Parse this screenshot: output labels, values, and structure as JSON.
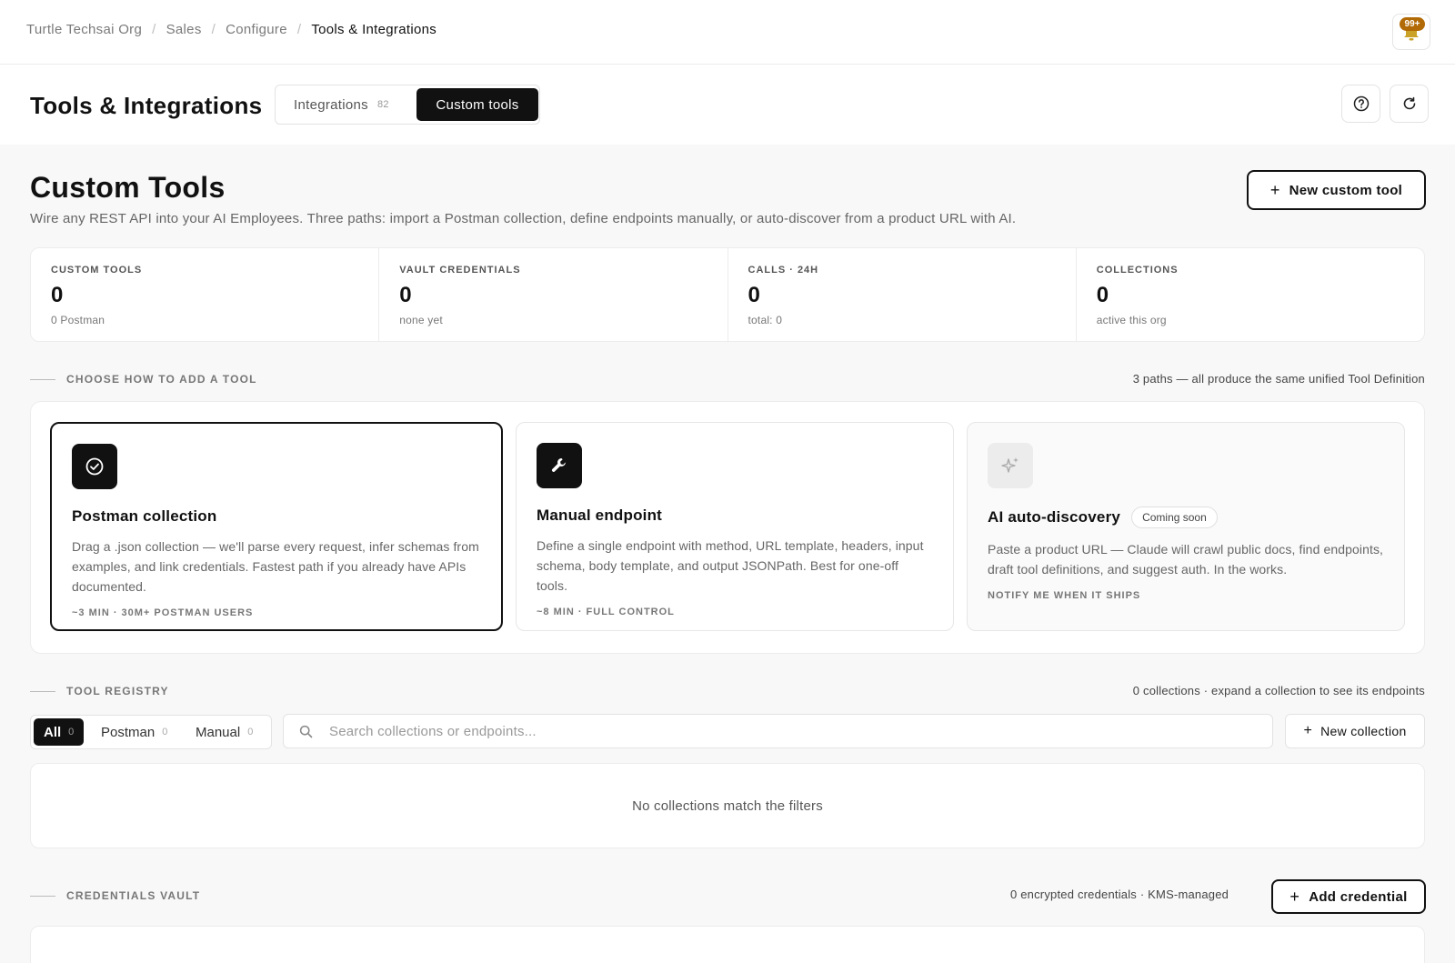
{
  "breadcrumb": [
    "Turtle Techsai Org",
    "Sales",
    "Configure",
    "Tools & Integrations"
  ],
  "notifications": {
    "badge": "99+"
  },
  "header": {
    "title": "Tools & Integrations",
    "tabs": [
      {
        "label": "Integrations",
        "count": "82"
      },
      {
        "label": "Custom tools"
      }
    ]
  },
  "custom_tools": {
    "title": "Custom Tools",
    "subtitle": "Wire any REST API into your AI Employees. Three paths: import a Postman collection, define endpoints manually, or auto-discover from a product URL with AI.",
    "new_button": "New custom tool"
  },
  "stats": [
    {
      "label": "CUSTOM TOOLS",
      "value": "0",
      "sub": "0 Postman"
    },
    {
      "label": "VAULT CREDENTIALS",
      "value": "0",
      "sub": "none yet"
    },
    {
      "label": "CALLS · 24H",
      "value": "0",
      "sub": "total: 0"
    },
    {
      "label": "COLLECTIONS",
      "value": "0",
      "sub": "active this org"
    }
  ],
  "choose": {
    "label": "CHOOSE HOW TO ADD A TOOL",
    "right": "3 paths — all produce the same unified Tool Definition",
    "cards": [
      {
        "title": "Postman collection",
        "desc": "Drag a .json collection — we'll parse every request, infer schemas from examples, and link credentials. Fastest path if you already have APIs documented.",
        "meta": "~3 MIN · 30M+ POSTMAN USERS",
        "icon": "check-circle-icon"
      },
      {
        "title": "Manual endpoint",
        "desc": "Define a single endpoint with method, URL template, headers, input schema, body template, and output JSONPath. Best for one-off tools.",
        "meta": "~8 MIN · FULL CONTROL",
        "icon": "wrench-icon"
      },
      {
        "title": "AI auto-discovery",
        "badge": "Coming soon",
        "desc": "Paste a product URL — Claude will crawl public docs, find endpoints, draft tool definitions, and suggest auth. In the works.",
        "meta": "NOTIFY ME WHEN IT SHIPS",
        "icon": "sparkle-icon"
      }
    ]
  },
  "registry": {
    "label": "TOOL REGISTRY",
    "right": "0 collections · expand a collection to see its endpoints",
    "filters": [
      {
        "label": "All",
        "count": "0"
      },
      {
        "label": "Postman",
        "count": "0"
      },
      {
        "label": "Manual",
        "count": "0"
      }
    ],
    "search_placeholder": "Search collections or endpoints...",
    "new_collection": "New collection",
    "empty": "No collections match the filters"
  },
  "vault": {
    "label": "CREDENTIALS VAULT",
    "right": "0 encrypted credentials · KMS-managed",
    "add_button": "Add credential"
  },
  "colors": {
    "accent": "#111111",
    "badge": "#b26a06",
    "muted_text": "#777777"
  }
}
